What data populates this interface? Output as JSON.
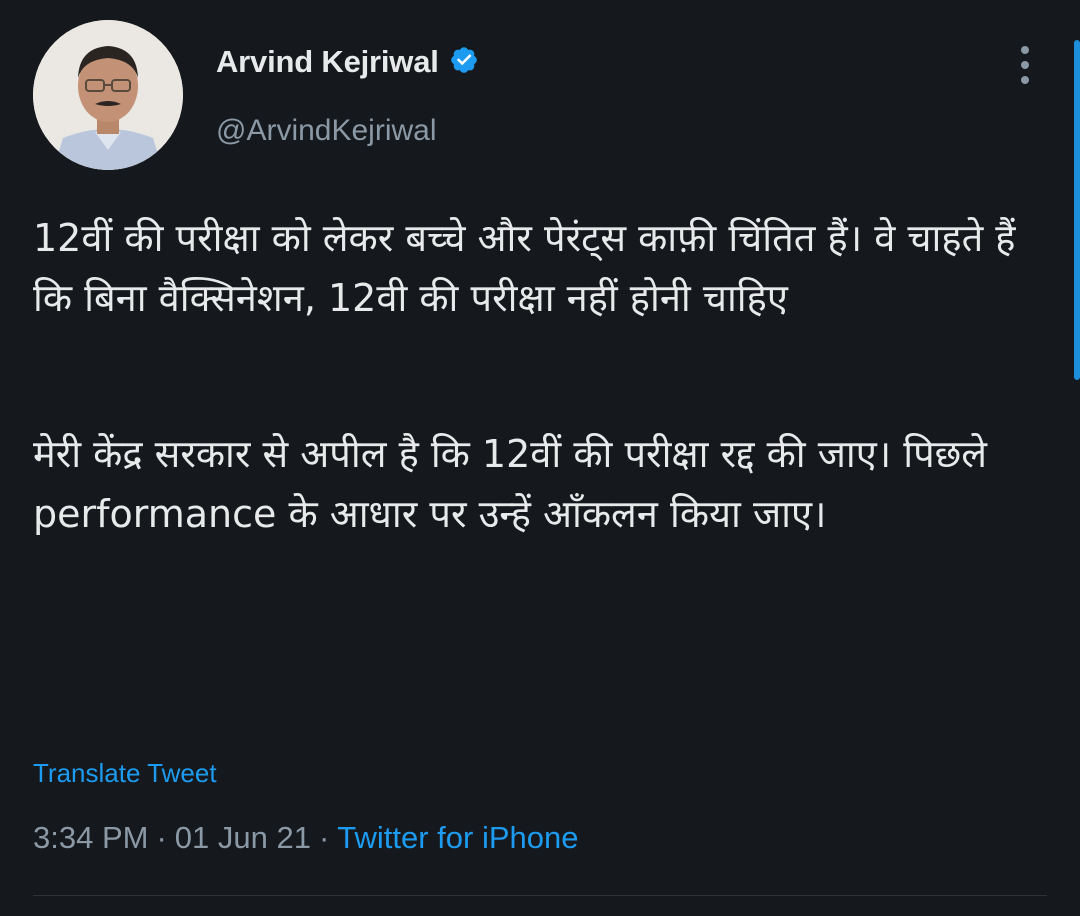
{
  "author": {
    "name": "Arvind Kejriwal",
    "handle": "@ArvindKejriwal",
    "verified": true
  },
  "tweet": {
    "paragraph1": "12वीं की परीक्षा को लेकर बच्चे और पेरंट्स काफ़ी चिंतित हैं। वे चाहते हैं कि बिना वैक्सिनेशन, 12वी की परीक्षा नहीं होनी चाहिए",
    "paragraph2": "मेरी केंद्र सरकार से अपील है कि 12वीं की परीक्षा रद्द की जाए। पिछले performance के आधार पर उन्हें आँकलन किया जाए।"
  },
  "translate_label": "Translate Tweet",
  "meta": {
    "time": "3:34 PM",
    "separator": "·",
    "date": "01 Jun 21",
    "source": "Twitter for iPhone"
  },
  "colors": {
    "background": "#15181c",
    "accent": "#1d9bf0",
    "text": "#e7e9ea",
    "secondary": "#8b98a5"
  },
  "icons": {
    "verified": "verified-badge-icon",
    "more": "more-options-icon"
  }
}
